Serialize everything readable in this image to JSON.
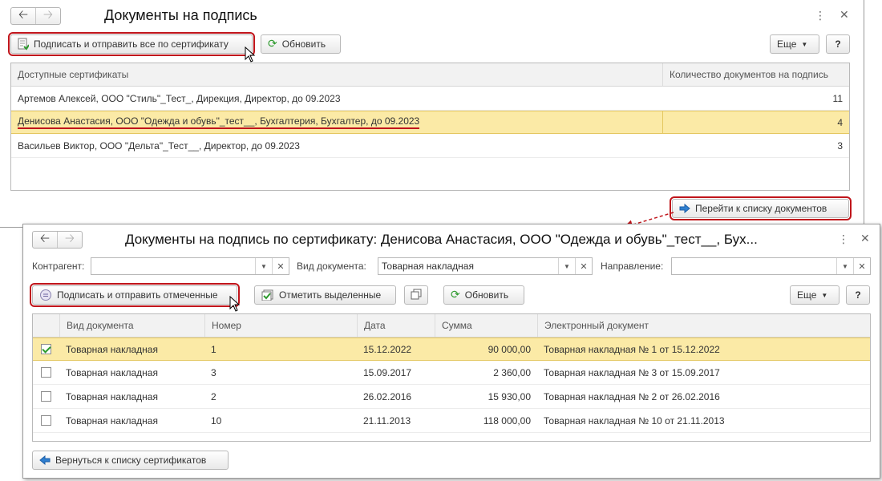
{
  "win1": {
    "title": "Документы на подпись",
    "sign_all_label": "Подписать и отправить все по сертификату",
    "refresh_label": "Обновить",
    "more_label": "Еще",
    "help_label": "?",
    "columns": [
      "Доступные сертификаты",
      "Количество документов на подпись"
    ],
    "rows": [
      {
        "cert": "Артемов Алексей, ООО \"Стиль\"_Тест_, Дирекция, Директор, до 09.2023",
        "count": "11"
      },
      {
        "cert": "Денисова Анастасия, ООО \"Одежда и обувь\"_тест__, Бухгалтерия, Бухгалтер, до 09.2023",
        "count": "4"
      },
      {
        "cert": "Васильев Виктор, ООО \"Дельта\"_Тест__, Директор, до 09.2023",
        "count": "3"
      }
    ],
    "selected_row": 1,
    "goto_label": "Перейти к списку документов"
  },
  "win2": {
    "title": "Документы на подпись по сертификату: Денисова Анастасия, ООО \"Одежда и обувь\"_тест__, Бух...",
    "filters": {
      "contractor_label": "Контрагент:",
      "contractor_value": "",
      "doctype_label": "Вид документа:",
      "doctype_value": "Товарная накладная",
      "direction_label": "Направление:",
      "direction_value": ""
    },
    "sign_marked_label": "Подписать и отправить отмеченные",
    "mark_selected_label": "Отметить выделенные",
    "refresh_label": "Обновить",
    "more_label": "Еще",
    "help_label": "?",
    "columns": [
      "Вид документа",
      "Номер",
      "Дата",
      "Сумма",
      "Электронный документ"
    ],
    "rows": [
      {
        "checked": true,
        "type": "Товарная накладная",
        "number": "1",
        "date": "15.12.2022",
        "sum": "90 000,00",
        "edoc": "Товарная накладная № 1 от 15.12.2022"
      },
      {
        "checked": false,
        "type": "Товарная накладная",
        "number": "3",
        "date": "15.09.2017",
        "sum": "2 360,00",
        "edoc": "Товарная накладная № 3 от 15.09.2017"
      },
      {
        "checked": false,
        "type": "Товарная накладная",
        "number": "2",
        "date": "26.02.2016",
        "sum": "15 930,00",
        "edoc": "Товарная накладная № 2 от 26.02.2016"
      },
      {
        "checked": false,
        "type": "Товарная накладная",
        "number": "10",
        "date": "21.11.2013",
        "sum": "118 000,00",
        "edoc": "Товарная накладная № 10 от 21.11.2013"
      }
    ],
    "selected_row": 0,
    "back_label": "Вернуться к списку сертификатов"
  },
  "icons": {
    "back": "arrow-left-icon",
    "forward": "arrow-right-icon",
    "menu": "more-vertical-icon",
    "close": "close-icon",
    "refresh": "refresh-icon",
    "sign": "sign-document-icon",
    "goto": "arrow-right-icon",
    "copy": "copy-icon",
    "back_list": "arrow-left-icon"
  },
  "colors": {
    "highlight_outline": "#c0151b",
    "selected_row": "#fbeaa6",
    "refresh_green": "#2e9a2e",
    "nav_blue": "#2f7fd0"
  }
}
